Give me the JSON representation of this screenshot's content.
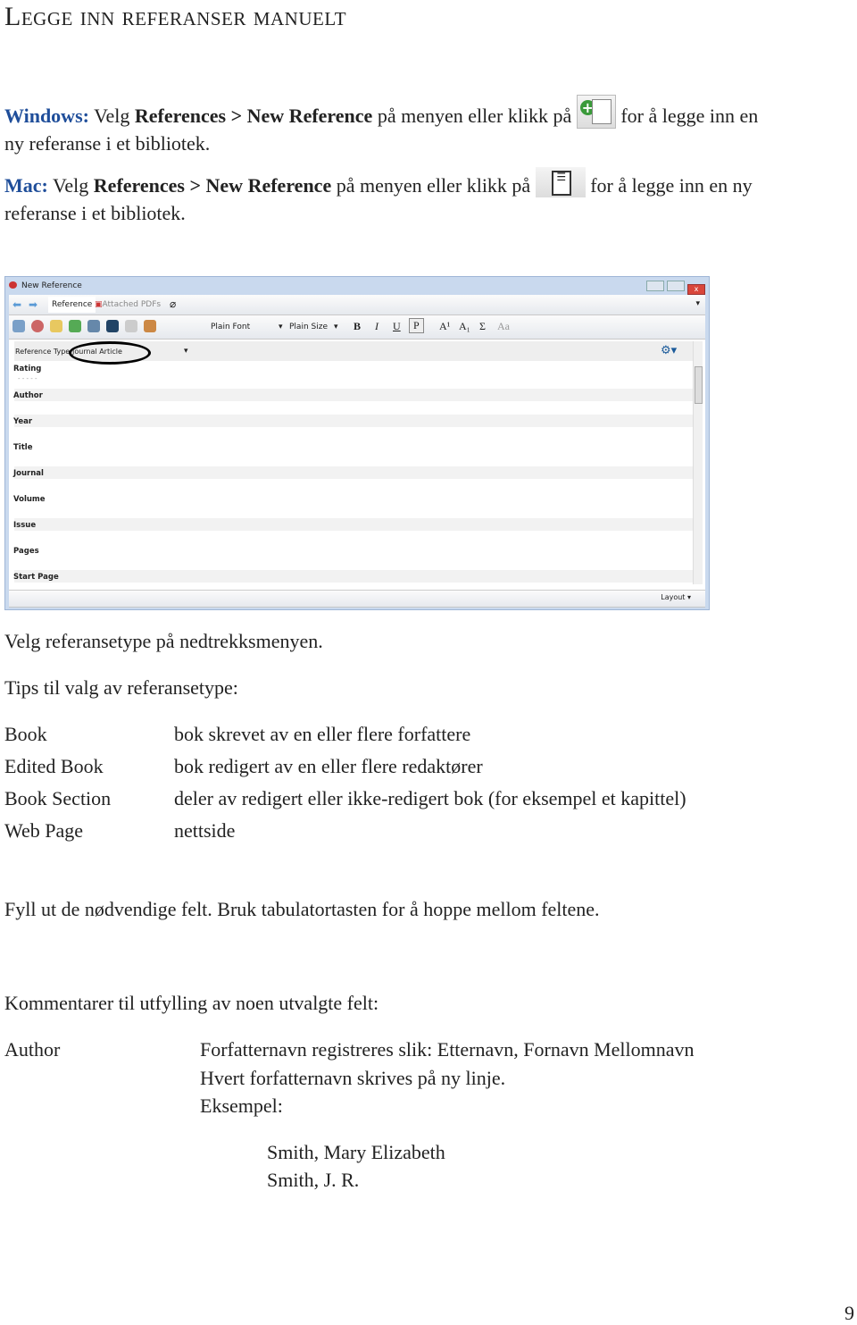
{
  "title": "Legge inn referanser manuelt",
  "windows": {
    "label": "Windows:",
    "t1": "Velg",
    "ref": "References > New Reference",
    "t2": "på menyen eller klikk på",
    "t3": "for å legge inn en",
    "t4": "ny referanse i et bibliotek.",
    "icon": "new-reference-icon"
  },
  "mac": {
    "label": "Mac:",
    "t1": "Velg",
    "ref": "References > New Reference",
    "t2": "på menyen eller klikk på",
    "t3": "for å legge inn en ny",
    "t4": "referanse i et bibliotek.",
    "icon": "new-reference-mac-icon"
  },
  "window": {
    "title": "New Reference",
    "tabs": [
      "Reference",
      "Attached PDFs"
    ],
    "font": "Plain Font",
    "size": "Plain Size",
    "format": [
      "B",
      "I",
      "U",
      "P",
      "A¹",
      "A₁",
      "Σ",
      "Aa"
    ],
    "ref_type_label": "Reference Type",
    "ref_type_value": "Journal Article",
    "rating_dots": "- - - - -",
    "fields": [
      "Rating",
      "Author",
      "Year",
      "Title",
      "Journal",
      "Volume",
      "Issue",
      "Pages",
      "Start Page"
    ],
    "layout": "Layout"
  },
  "p1": "Velg referansetype på nedtrekksmenyen.",
  "p2": "Tips til valg av referansetype:",
  "tips": [
    {
      "type": "Book",
      "desc": "bok skrevet av en eller flere forfattere"
    },
    {
      "type": "Edited Book",
      "desc": "bok redigert av en eller flere redaktører"
    },
    {
      "type": "Book Section",
      "desc": "deler av redigert eller ikke-redigert bok (for eksempel et kapittel)"
    },
    {
      "type": "Web Page",
      "desc": "nettside"
    }
  ],
  "p3": "Fyll ut de nødvendige felt. Bruk tabulatortasten for å hoppe mellom feltene.",
  "p4": "Kommentarer til utfylling av noen utvalgte felt:",
  "author": {
    "label": "Author",
    "lines": [
      "Forfatternavn registreres slik: Etternavn, Fornavn Mellomnavn",
      "Hvert forfatternavn skrives på ny linje.",
      "Eksempel:"
    ],
    "examples": [
      "Smith, Mary Elizabeth",
      "Smith, J. R."
    ]
  },
  "page_number": "9"
}
